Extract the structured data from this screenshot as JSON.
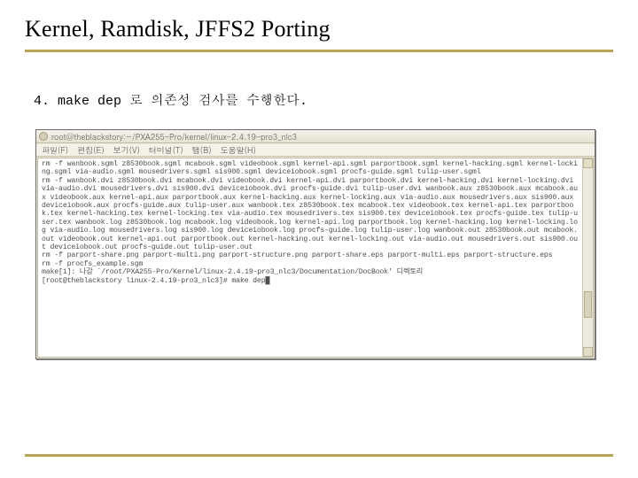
{
  "title": "Kernel, Ramdisk, JFFS2 Porting",
  "step": {
    "number": "4.",
    "text": "make dep 로 의존성 검사를 수행한다."
  },
  "terminal": {
    "title": "root@theblackstory:~/PXA255-Pro/kernel/linux-2.4.19-pro3_nlc3",
    "menus": [
      "파일(F)",
      "편집(E)",
      "보기(V)",
      "터미널(T)",
      "탭(B)",
      "도움말(H)"
    ],
    "output": "rm -f wanbook.sgml z8530book.sgml mcabook.sgml videobook.sgml kernel-api.sgml parportbook.sgml kernel-hacking.sgml kernel-locking.sgml via-audio.sgml mousedrivers.sgml sis900.sgml deviceiobook.sgml procfs-guide.sgml tulip-user.sgml\nrm -f wanbook.dvi z8530book.dvi mcabook.dvi videobook.dvi kernel-api.dvi parportbook.dvi kernel-hacking.dvi kernel-locking.dvi via-audio.dvi mousedrivers.dvi sis900.dvi deviceiobook.dvi procfs-guide.dvi tulip-user.dvi wanbook.aux z8530book.aux mcabook.aux videobook.aux kernel-api.aux parportbook.aux kernel-hacking.aux kernel-locking.aux via-audio.aux mousedrivers.aux sis900.aux deviceiobook.aux procfs-guide.aux tulip-user.aux wanbook.tex z8530book.tex mcabook.tex videobook.tex kernel-api.tex parportbook.tex kernel-hacking.tex kernel-locking.tex via-audio.tex mousedrivers.tex sis900.tex deviceiobook.tex procfs-guide.tex tulip-user.tex wanbook.log z8530book.log mcabook.log videobook.log kernel-api.log parportbook.log kernel-hacking.log kernel-locking.log via-audio.log mousedrivers.log sis900.log deviceiobook.log procfs-guide.log tulip-user.log wanbook.out z8530book.out mcabook.out videobook.out kernel-api.out parportbook.out kernel-hacking.out kernel-locking.out via-audio.out mousedrivers.out sis900.out deviceiobook.out procfs-guide.out tulip-user.out\nrm -f parport-share.png parport-multi.png parport-structure.png parport-share.eps parport-multi.eps parport-structure.eps\nrm -f procfs_example.sgm\nmake[1]: 나감 `/root/PXA255-Pro/Kernel/linux-2.4.19-pro3_nlc3/Documentation/DocBook' 디렉토리\n[root@theblackstory linux-2.4.19-pro3_nlc3]# make dep█"
  }
}
